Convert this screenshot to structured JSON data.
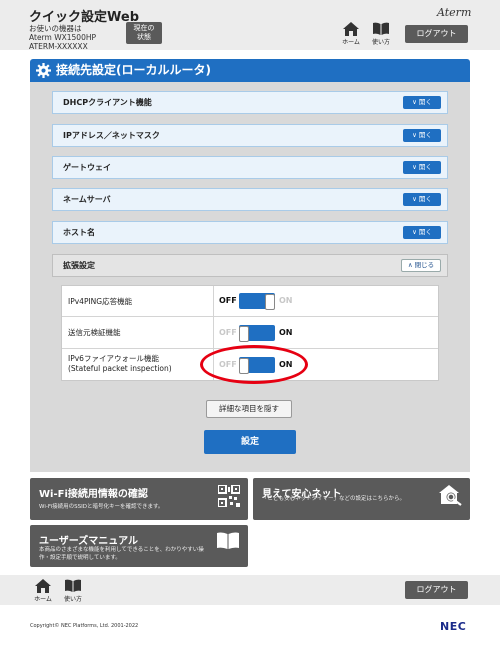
{
  "header": {
    "app_title": "クイック設定Web",
    "device_lines": [
      "お使いの機器は",
      "Aterm WX1500HP",
      "ATERM-XXXXXX"
    ],
    "status_button": [
      "現在の",
      "状態"
    ],
    "brand": "Aterm",
    "home_label": "ホーム",
    "howto_label": "使い方",
    "logout_label": "ログアウト"
  },
  "section": {
    "title": "接続先設定(ローカルルータ)"
  },
  "accordions": [
    {
      "label": "DHCPクライアント機能",
      "button": "開く"
    },
    {
      "label": "IPアドレス／ネットマスク",
      "button": "開く"
    },
    {
      "label": "ゲートウェイ",
      "button": "開く"
    },
    {
      "label": "ネームサーバ",
      "button": "開く"
    },
    {
      "label": "ホスト名",
      "button": "開く"
    }
  ],
  "expanded": {
    "label": "拡張設定",
    "button": "閉じる"
  },
  "settings": [
    {
      "label_lines": [
        "IPv4PING応答機能"
      ],
      "state": "OFF",
      "off_text": "OFF",
      "on_text": "ON"
    },
    {
      "label_lines": [
        "送信元検証機能"
      ],
      "state": "ON",
      "off_text": "OFF",
      "on_text": "ON"
    },
    {
      "label_lines": [
        "IPv6ファイアウォール機能",
        "(Stateful packet inspection)"
      ],
      "state": "ON",
      "off_text": "OFF",
      "on_text": "ON"
    }
  ],
  "buttons": {
    "detail": "詳細な項目を隠す",
    "apply": "設定"
  },
  "cards": {
    "wifi": {
      "title": "Wi-Fi接続用情報の確認",
      "desc": "Wi-Fi接続用のSSIDと暗号化キーを確認できます。",
      "icon": "qr-code-icon"
    },
    "safety": {
      "title": "見えて安心ネット",
      "desc": "「こども安心ネットタイマー」などの設定はこちらから。",
      "icon": "house-search-icon"
    },
    "manual": {
      "title": "ユーザーズマニュアル",
      "desc_lines": [
        "本商品のさまざまな機能を利用してできることを、わかりやすい操",
        "作・設定手順で説明しています。"
      ],
      "icon": "book-icon"
    }
  },
  "footer": {
    "home_label": "ホーム",
    "howto_label": "使い方",
    "logout_label": "ログアウト",
    "copyright": "Copyright© NEC Platforms, Ltd. 2001-2022",
    "logo": "NEC"
  },
  "colors": {
    "accent": "#1f6fc2",
    "dark_button": "#5a5a5a",
    "highlight": "#e60012"
  }
}
